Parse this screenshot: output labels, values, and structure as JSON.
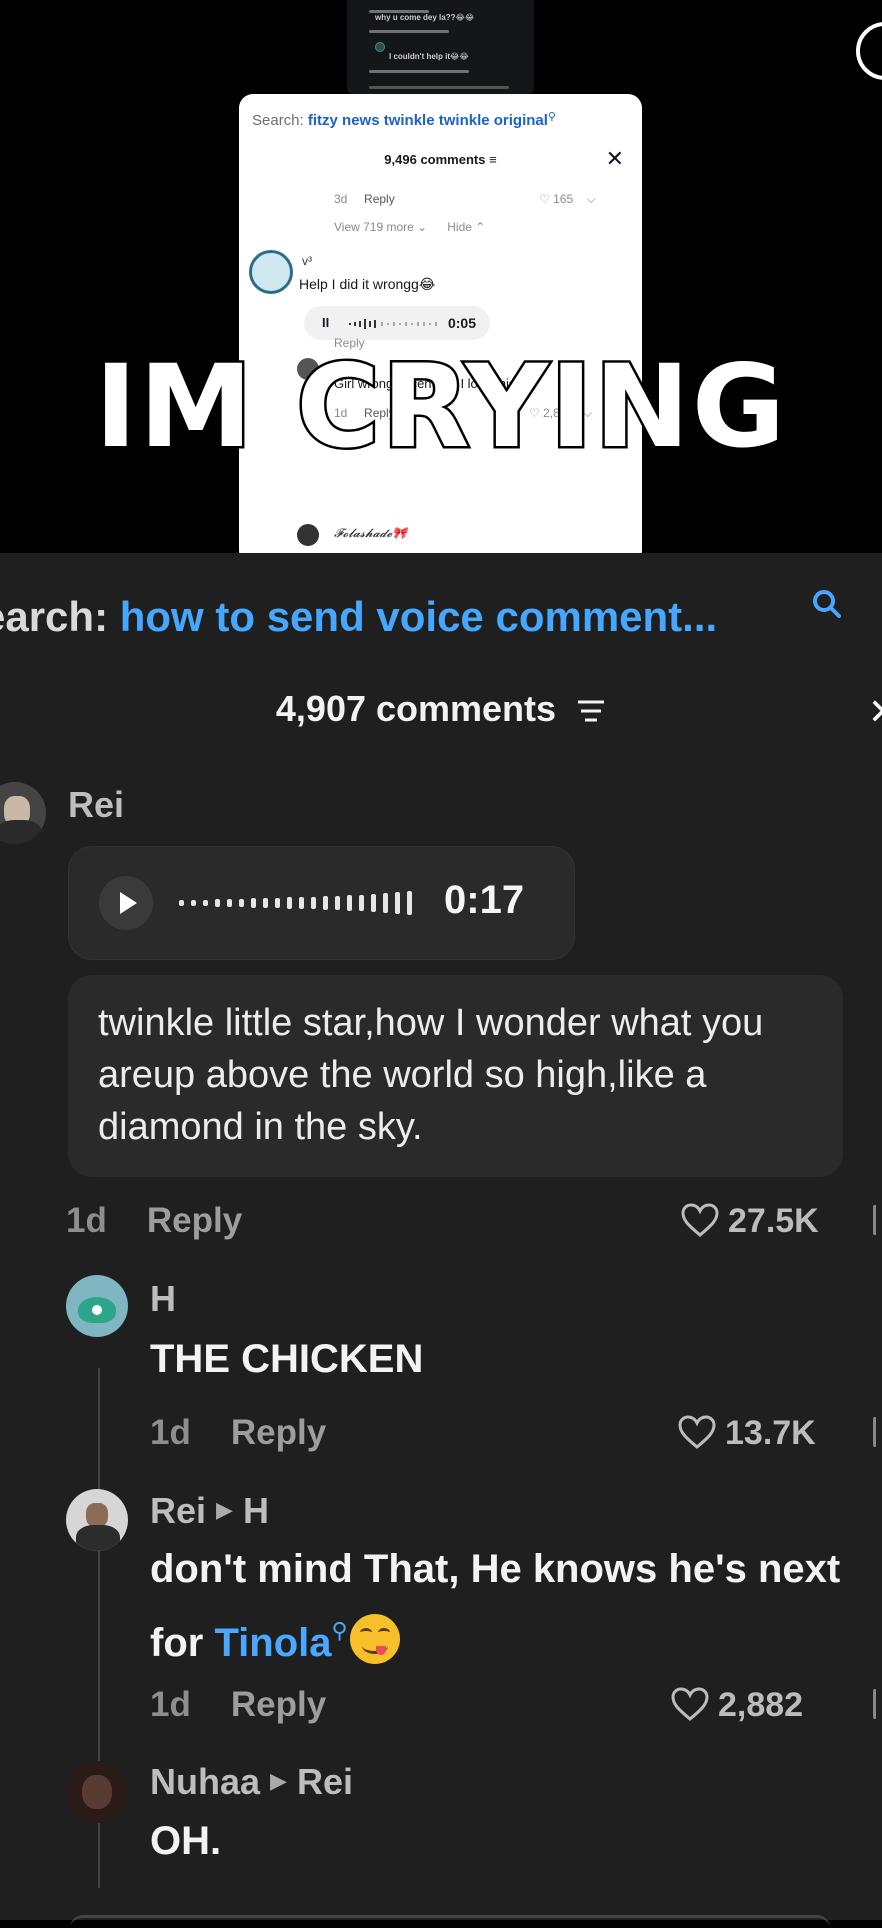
{
  "video": {
    "overlay_text": "IM CRYING",
    "mini_comments": [
      {
        "text": "why u come dey la??😂😂"
      },
      {
        "text": "I couldn't help it😂😂"
      }
    ],
    "phone": {
      "search_prefix": "Search: ",
      "search_query": "fitzy news twinkle twinkle original",
      "comment_count": "9,496 comments",
      "close": "✕",
      "row1": {
        "age": "3d",
        "reply": "Reply",
        "likes": "165"
      },
      "view_more": "View 719 more",
      "hide": "Hide",
      "voice_user": {
        "name": "v³",
        "text": "Help I did it wrongg😂",
        "duration": "0:05"
      },
      "reply_stub": "Reply",
      "row2": {
        "text": "Girl wrong accent but I love this 😂",
        "age": "1d",
        "reply": "Reply",
        "likes": "2,828"
      },
      "row3": {
        "name": "𝓕𝓸𝓵𝓪𝓼𝓱𝓪𝓭𝓮🎀"
      }
    }
  },
  "panel": {
    "search_prefix": "earch: ",
    "search_query": "how to send voice comment...",
    "comment_count": "4,907 comments",
    "close": "✕",
    "comments": [
      {
        "user": "Rei",
        "voice_duration": "0:17",
        "transcript": "twinkle little star,how I wonder what you areup above the world so high,like a diamond in the sky.",
        "age": "1d",
        "reply": "Reply",
        "likes": "27.5K"
      },
      {
        "user": "H",
        "text": "THE CHICKEN",
        "age": "1d",
        "reply": "Reply",
        "likes": "13.7K"
      },
      {
        "user": "Rei",
        "reply_to": "H",
        "text_before": "don't mind That, He knows he's next for ",
        "link": "Tinola",
        "age": "1d",
        "reply": "Reply",
        "likes": "2,882"
      },
      {
        "user": "Nuhaa",
        "reply_to": "Rei",
        "text": "OH."
      }
    ]
  },
  "colors": {
    "link": "#46a7ff",
    "panel_bg": "#1f1f1f",
    "accent_avatar": "#3fb59a"
  }
}
